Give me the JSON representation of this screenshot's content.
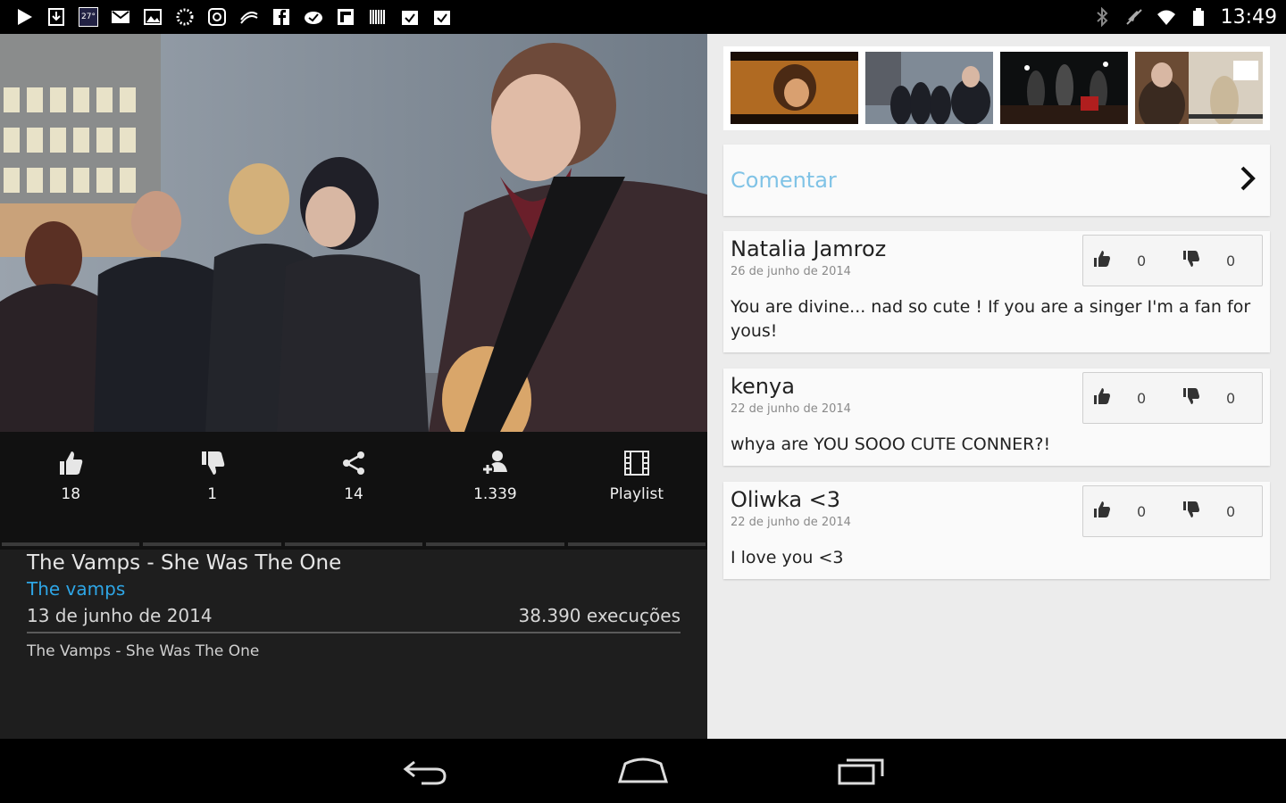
{
  "status_bar": {
    "time": "13:49",
    "temp": "27°",
    "left_icons": [
      "play-icon",
      "download-icon",
      "weather-icon",
      "gmail-icon",
      "gallery-icon",
      "loading-icon",
      "instagram-icon",
      "app-icon",
      "facebook-icon",
      "check-icon",
      "flipboard-icon",
      "barcode-icon",
      "task-icon",
      "task-icon"
    ],
    "right_icons": [
      "bluetooth-icon",
      "mute-icon",
      "wifi-icon",
      "battery-icon"
    ]
  },
  "actions": [
    {
      "name": "like",
      "label": "18"
    },
    {
      "name": "dislike",
      "label": "1"
    },
    {
      "name": "share",
      "label": "14"
    },
    {
      "name": "follow",
      "label": "1.339"
    },
    {
      "name": "playlist",
      "label": "Playlist"
    }
  ],
  "video_info": {
    "title": "The Vamps - She Was The One",
    "artist": "The vamps",
    "date": "13 de junho de 2014",
    "plays": "38.390 execuções",
    "description": "The Vamps - She Was The One"
  },
  "comment_button": {
    "label": "Comentar"
  },
  "comments": [
    {
      "author": "Natalia Jamroz",
      "date": "26 de junho de 2014",
      "text": "You are divine... nad so cute ! If you are a singer I'm a fan for yous!",
      "likes": "0",
      "dislikes": "0"
    },
    {
      "author": "kenya",
      "date": "22 de junho de 2014",
      "text": "whya are YOU SOOO CUTE CONNER?!",
      "likes": "0",
      "dislikes": "0"
    },
    {
      "author": "Oliwka <3",
      "date": "22 de junho de 2014",
      "text": "I love you <3",
      "likes": "0",
      "dislikes": "0"
    }
  ],
  "colors": {
    "accent": "#2ea6e6",
    "comment_label": "#80c3e6"
  }
}
